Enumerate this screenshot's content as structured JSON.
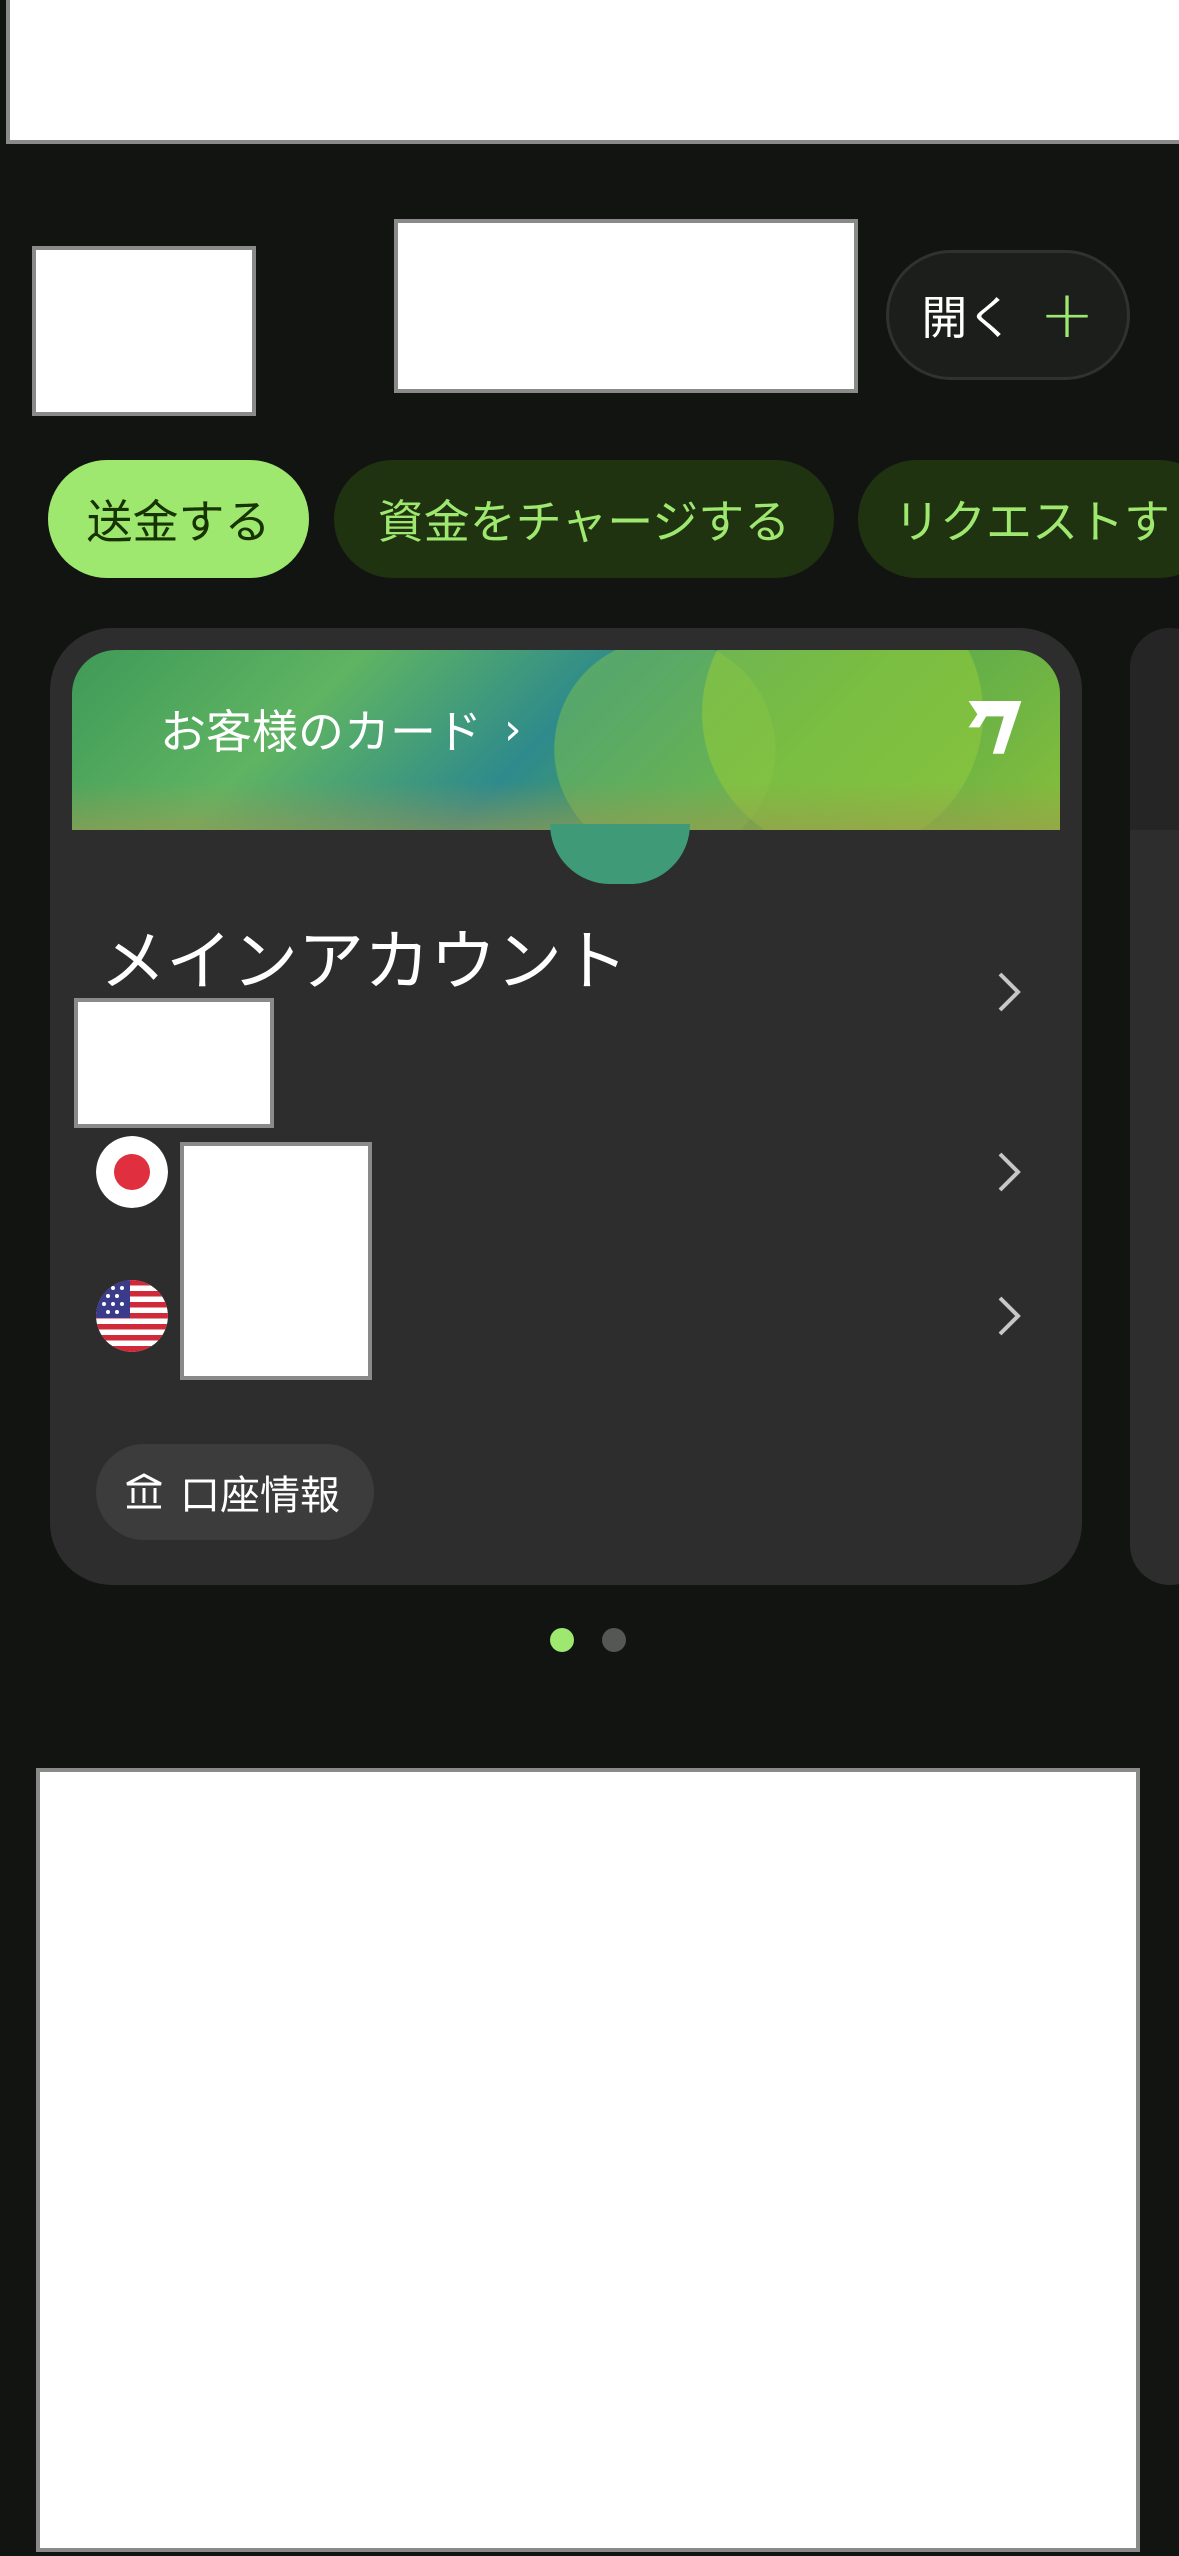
{
  "header": {
    "open_button": {
      "label": "開く",
      "plus": "+"
    }
  },
  "actions": [
    {
      "label": "送金する"
    },
    {
      "label": "資金をチャージする"
    },
    {
      "label": "リクエストす"
    }
  ],
  "card": {
    "banner_label": "お客様のカード",
    "banner_chevron": "›",
    "account_title": "メインアカウント",
    "balances": [
      {
        "currency_flag": "japan-flag-icon"
      },
      {
        "currency_flag": "us-flag-icon"
      }
    ],
    "account_info_label": "口座情報"
  },
  "pager": {
    "pages": 2,
    "active": 1
  },
  "colors": {
    "background": "#121412",
    "accent": "#9fe870",
    "chip_secondary_bg": "#203310",
    "card_bg": "#2c2d2c"
  }
}
